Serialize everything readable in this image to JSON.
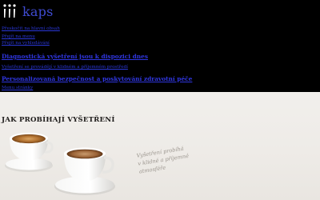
{
  "header": {
    "logo_text": "kaps",
    "logo_icon": "kaps-logo-icon"
  },
  "nav": {
    "links": [
      "Přeskočit na hlavní obsah",
      "Přejít na menu",
      "Přejít na vyhledávání",
      "Diagnostická vyšetření jsou k dispozici dnes",
      "Vyšetření se provádějí v klidném a příjemném prostředí",
      "Personalizovaná bezpečnost a poskytování zdravotní péče",
      "Menu stránky"
    ]
  },
  "hero": {
    "title": "JAK PROBÍHAJÍ VYŠETŘENÍ",
    "tagline_lines": [
      "Vyšetření probíhá",
      "v klidné a příjemné",
      "atmosféře"
    ],
    "accent_color": "#3f4bd1"
  }
}
